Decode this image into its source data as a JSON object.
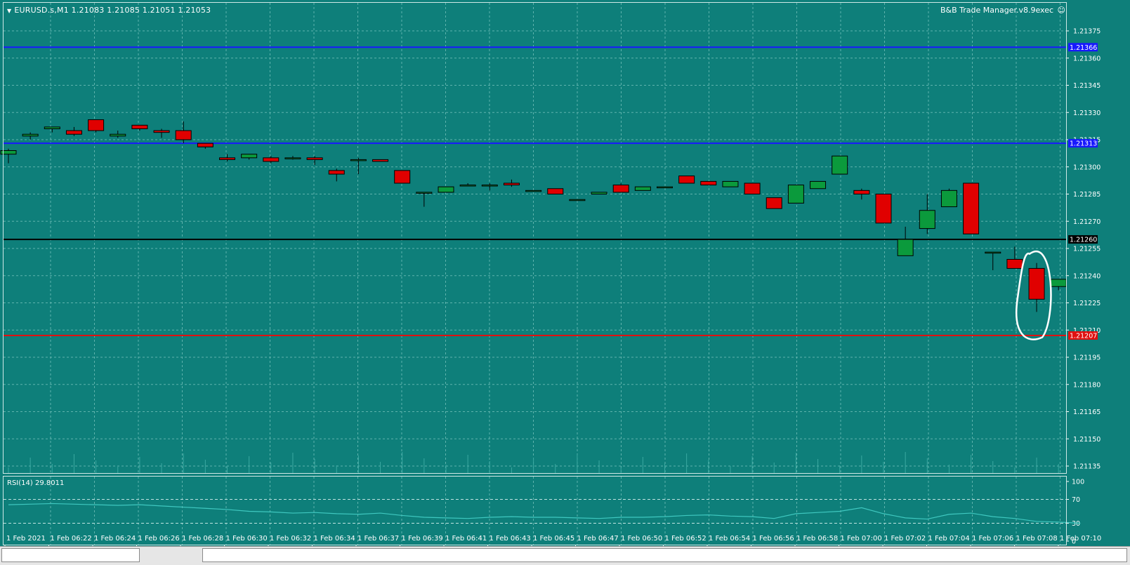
{
  "window": {
    "symbol_header": "EURUSD.s,M1  1.21083 1.21085 1.21051 1.21053",
    "ea_label": "B&B Trade Manager.v8.9exec",
    "rsi_label": "RSI(14) 29.8011"
  },
  "colors": {
    "background": "#0e7f7a",
    "bull_candle": "#0b9a3c",
    "bear_candle": "#e00000",
    "blue_line": "#1818ff",
    "black_line": "#000000",
    "red_line": "#e01010",
    "grid": "#5fb3ad",
    "rsi_line": "#3fc8c0"
  },
  "price_axis": {
    "ticks": [
      "1.21375",
      "1.21360",
      "1.21345",
      "1.21330",
      "1.21315",
      "1.21300",
      "1.21285",
      "1.21270",
      "1.21255",
      "1.21240",
      "1.21225",
      "1.21210",
      "1.21195",
      "1.21180",
      "1.21165",
      "1.21150",
      "1.21135"
    ]
  },
  "levels": {
    "blue_top": "1.21366",
    "blue_mid": "1.21313",
    "black": "1.21260",
    "red": "1.21207"
  },
  "rsi_axis": {
    "ticks": [
      "100",
      "70",
      "30",
      "0"
    ]
  },
  "time_axis": {
    "labels": [
      "1 Feb 2021",
      "1 Feb 06:22",
      "1 Feb 06:24",
      "1 Feb 06:26",
      "1 Feb 06:28",
      "1 Feb 06:30",
      "1 Feb 06:32",
      "1 Feb 06:34",
      "1 Feb 06:37",
      "1 Feb 06:39",
      "1 Feb 06:41",
      "1 Feb 06:43",
      "1 Feb 06:45",
      "1 Feb 06:47",
      "1 Feb 06:50",
      "1 Feb 06:52",
      "1 Feb 06:54",
      "1 Feb 06:56",
      "1 Feb 06:58",
      "1 Feb 07:00",
      "1 Feb 07:02",
      "1 Feb 07:04",
      "1 Feb 07:06",
      "1 Feb 07:08",
      "1 Feb 07:10"
    ]
  },
  "chart_data": {
    "type": "candlestick",
    "title": "EURUSD.s,M1",
    "ylim": [
      1.2113,
      1.2139
    ],
    "candles": [
      {
        "o": 1.21307,
        "h": 1.2131,
        "l": 1.21302,
        "c": 1.21309
      },
      {
        "o": 1.21317,
        "h": 1.21319,
        "l": 1.21315,
        "c": 1.21318
      },
      {
        "o": 1.21321,
        "h": 1.21322,
        "l": 1.21319,
        "c": 1.21322
      },
      {
        "o": 1.2132,
        "h": 1.21322,
        "l": 1.21317,
        "c": 1.21318
      },
      {
        "o": 1.21326,
        "h": 1.21326,
        "l": 1.21319,
        "c": 1.2132
      },
      {
        "o": 1.21317,
        "h": 1.2132,
        "l": 1.21316,
        "c": 1.21318
      },
      {
        "o": 1.21323,
        "h": 1.21323,
        "l": 1.2132,
        "c": 1.21321
      },
      {
        "o": 1.2132,
        "h": 1.21321,
        "l": 1.21316,
        "c": 1.21319
      },
      {
        "o": 1.2132,
        "h": 1.21325,
        "l": 1.21313,
        "c": 1.21315
      },
      {
        "o": 1.21313,
        "h": 1.21313,
        "l": 1.2131,
        "c": 1.21311
      },
      {
        "o": 1.21305,
        "h": 1.21307,
        "l": 1.21303,
        "c": 1.21304
      },
      {
        "o": 1.21305,
        "h": 1.21307,
        "l": 1.21304,
        "c": 1.21307
      },
      {
        "o": 1.21305,
        "h": 1.21306,
        "l": 1.21302,
        "c": 1.21303
      },
      {
        "o": 1.21305,
        "h": 1.21306,
        "l": 1.21304,
        "c": 1.21305
      },
      {
        "o": 1.21305,
        "h": 1.21306,
        "l": 1.21301,
        "c": 1.21304
      },
      {
        "o": 1.21298,
        "h": 1.21299,
        "l": 1.21292,
        "c": 1.21296
      },
      {
        "o": 1.21304,
        "h": 1.21305,
        "l": 1.21296,
        "c": 1.21304
      },
      {
        "o": 1.21304,
        "h": 1.21304,
        "l": 1.21303,
        "c": 1.21303
      },
      {
        "o": 1.21298,
        "h": 1.21298,
        "l": 1.21291,
        "c": 1.21291
      },
      {
        "o": 1.21286,
        "h": 1.21286,
        "l": 1.21278,
        "c": 1.21286
      },
      {
        "o": 1.21286,
        "h": 1.21289,
        "l": 1.21286,
        "c": 1.21289
      },
      {
        "o": 1.2129,
        "h": 1.21291,
        "l": 1.2129,
        "c": 1.2129
      },
      {
        "o": 1.2129,
        "h": 1.21291,
        "l": 1.21287,
        "c": 1.2129
      },
      {
        "o": 1.21291,
        "h": 1.21293,
        "l": 1.21289,
        "c": 1.2129
      },
      {
        "o": 1.21287,
        "h": 1.21287,
        "l": 1.21287,
        "c": 1.21287
      },
      {
        "o": 1.21288,
        "h": 1.21288,
        "l": 1.21285,
        "c": 1.21285
      },
      {
        "o": 1.21282,
        "h": 1.21282,
        "l": 1.21282,
        "c": 1.21282
      },
      {
        "o": 1.21285,
        "h": 1.21286,
        "l": 1.21285,
        "c": 1.21286
      },
      {
        "o": 1.2129,
        "h": 1.21291,
        "l": 1.21286,
        "c": 1.21286
      },
      {
        "o": 1.21287,
        "h": 1.21289,
        "l": 1.21287,
        "c": 1.21289
      },
      {
        "o": 1.21289,
        "h": 1.21289,
        "l": 1.21289,
        "c": 1.21289
      },
      {
        "o": 1.21295,
        "h": 1.21295,
        "l": 1.21291,
        "c": 1.21291
      },
      {
        "o": 1.21292,
        "h": 1.21292,
        "l": 1.2129,
        "c": 1.2129
      },
      {
        "o": 1.21289,
        "h": 1.21292,
        "l": 1.21289,
        "c": 1.21292
      },
      {
        "o": 1.21291,
        "h": 1.21291,
        "l": 1.21285,
        "c": 1.21285
      },
      {
        "o": 1.21283,
        "h": 1.21283,
        "l": 1.21277,
        "c": 1.21277
      },
      {
        "o": 1.2128,
        "h": 1.2129,
        "l": 1.2128,
        "c": 1.2129
      },
      {
        "o": 1.21288,
        "h": 1.21292,
        "l": 1.21288,
        "c": 1.21292
      },
      {
        "o": 1.21296,
        "h": 1.21306,
        "l": 1.21296,
        "c": 1.21306
      },
      {
        "o": 1.21287,
        "h": 1.21288,
        "l": 1.21282,
        "c": 1.21285
      },
      {
        "o": 1.21285,
        "h": 1.21285,
        "l": 1.21269,
        "c": 1.21269
      },
      {
        "o": 1.21251,
        "h": 1.21267,
        "l": 1.21251,
        "c": 1.2126
      },
      {
        "o": 1.21266,
        "h": 1.21285,
        "l": 1.21263,
        "c": 1.21276
      },
      {
        "o": 1.21278,
        "h": 1.21288,
        "l": 1.21278,
        "c": 1.21287
      },
      {
        "o": 1.21291,
        "h": 1.21291,
        "l": 1.21263,
        "c": 1.21263
      },
      {
        "o": 1.21253,
        "h": 1.21253,
        "l": 1.21243,
        "c": 1.21253
      },
      {
        "o": 1.21249,
        "h": 1.21256,
        "l": 1.21244,
        "c": 1.21244
      },
      {
        "o": 1.21244,
        "h": 1.21247,
        "l": 1.2122,
        "c": 1.21227
      },
      {
        "o": 1.21234,
        "h": 1.21238,
        "l": 1.21232,
        "c": 1.21238
      }
    ],
    "rsi": [
      61,
      62,
      63,
      62,
      61,
      60,
      61,
      59,
      57,
      55,
      53,
      50,
      49,
      47,
      48,
      46,
      45,
      47,
      43,
      40,
      39,
      38,
      40,
      41,
      40,
      40,
      39,
      38,
      40,
      40,
      41,
      43,
      44,
      42,
      41,
      38,
      46,
      48,
      50,
      56,
      46,
      39,
      37,
      45,
      47,
      41,
      38,
      33,
      32,
      30
    ]
  }
}
